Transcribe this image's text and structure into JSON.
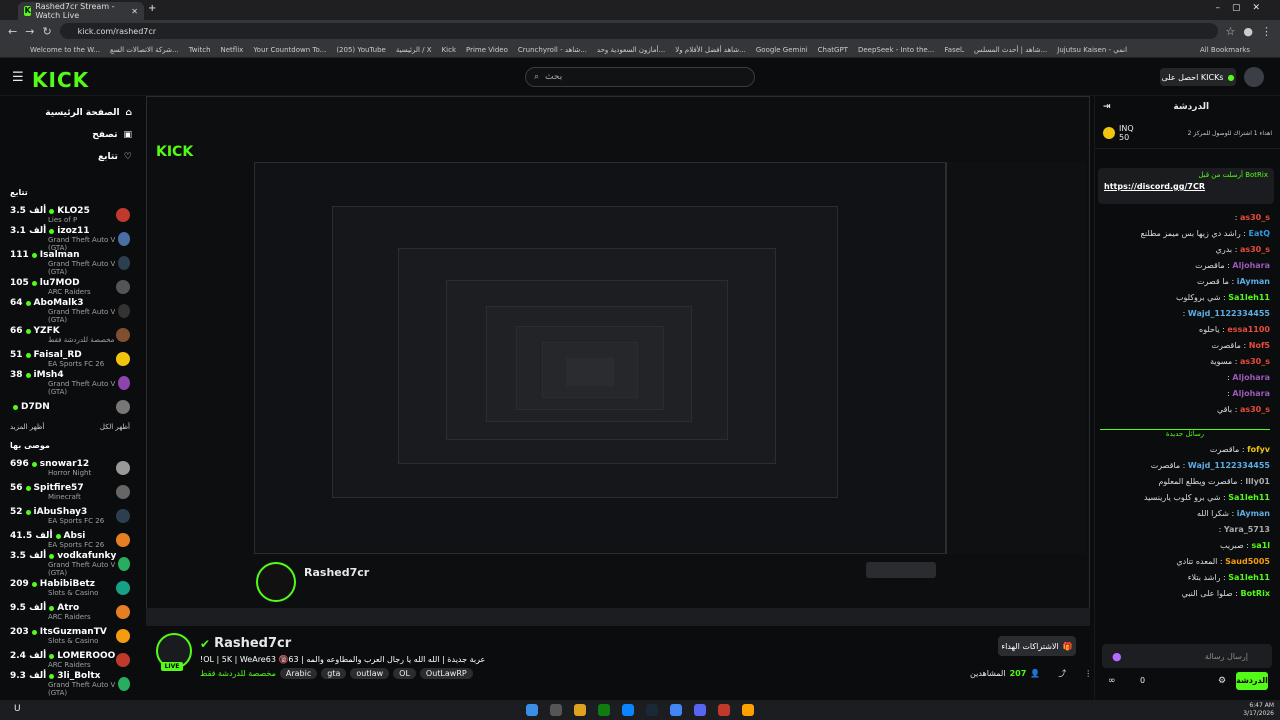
{
  "browser": {
    "tab_title": "Rashed7cr Stream - Watch Live",
    "url": "kick.com/rashed7cr",
    "bookmarks": [
      "Welcome to the W...",
      "شركة الاتصالات السع...",
      "Twitch",
      "Netflix",
      "Your Countdown To...",
      "(205) YouTube",
      "الرئيسية / X",
      "Kick",
      "Prime Video",
      "Crunchyroll - شاهد...",
      "أمازون السعودية وحد...",
      "شاهد أفضل الأفلام ولا...",
      "Google Gemini",
      "ChatGPT",
      "DeepSeek - Into the...",
      "Faselـ",
      "شاهد | أحدث المسلس...",
      "Jujutsu Kaisen - انمي"
    ],
    "all_bookmarks": "All Bookmarks"
  },
  "topbar": {
    "logo": "KICK",
    "search_placeholder": "بحث",
    "get_kicks": "احصل على KICKs"
  },
  "sidebar": {
    "nav": [
      "الصفحة الرئيسية",
      "تصفح",
      "تتابع"
    ],
    "following_title": "تتابع",
    "following": [
      {
        "viewers": "3.5 ألف",
        "name": "KLO25",
        "game": "Lies of P",
        "color": "#c0392b"
      },
      {
        "viewers": "3.1 ألف",
        "name": "izoz11",
        "game": "Grand Theft Auto V (GTA)",
        "color": "#4a6fa5"
      },
      {
        "viewers": "111",
        "name": "Isalman",
        "game": "Grand Theft Auto V (GTA)",
        "color": "#2c3e50"
      },
      {
        "viewers": "105",
        "name": "lu7MOD",
        "game": "ARC Raiders",
        "color": "#555"
      },
      {
        "viewers": "64",
        "name": "AboMalk3",
        "game": "Grand Theft Auto V (GTA)",
        "color": "#333"
      },
      {
        "viewers": "66",
        "name": "YZFK",
        "game": "مخصصة للدردشة فقط",
        "color": "#7f4f2f"
      },
      {
        "viewers": "51",
        "name": "Faisal_RD",
        "game": "EA Sports FC 26",
        "color": "#f1c40f"
      },
      {
        "viewers": "38",
        "name": "iMsh4",
        "game": "Grand Theft Auto V (GTA)",
        "color": "#8e44ad"
      },
      {
        "viewers": "",
        "name": "D7DN",
        "game": "",
        "color": "#777"
      }
    ],
    "show_more": "أظهر المزيد",
    "show_all": "أظهر الكل",
    "recommended_title": "موصى بها",
    "recommended": [
      {
        "viewers": "696",
        "name": "snowar12",
        "game": "Horror Night",
        "color": "#999"
      },
      {
        "viewers": "56",
        "name": "Spitfire57",
        "game": "Minecraft",
        "color": "#666"
      },
      {
        "viewers": "52",
        "name": "iAbuShay3",
        "game": "EA Sports FC 26",
        "color": "#2c3e50"
      },
      {
        "viewers": "41.5 ألف",
        "name": "Absi",
        "game": "EA Sports FC 26",
        "color": "#e67e22"
      },
      {
        "viewers": "3.5 ألف",
        "name": "vodkafunky",
        "game": "Grand Theft Auto V (GTA)",
        "color": "#27ae60"
      },
      {
        "viewers": "209",
        "name": "HabibiBetz",
        "game": "Slots & Casino",
        "color": "#16a085"
      },
      {
        "viewers": "9.5 ألف",
        "name": "Atro",
        "game": "ARC Raiders",
        "color": "#e67e22"
      },
      {
        "viewers": "203",
        "name": "ItsGuzmanTV",
        "game": "Slots & Casino",
        "color": "#f39c12"
      },
      {
        "viewers": "2.4 ألف",
        "name": "LOMEROOO",
        "game": "ARC Raiders",
        "color": "#c0392b"
      },
      {
        "viewers": "9.3 ألف",
        "name": "3li_Boltx",
        "game": "Grand Theft Auto V (GTA)",
        "color": "#27ae60"
      }
    ]
  },
  "channel": {
    "name": "Rashed7cr",
    "live": "LIVE",
    "title": "!OL | 5K | WeAre63 🔞63 | عربة جديدة | الله الله يا رجال العرب والمطاوعه والمه",
    "category": "مخصصة للدردشة فقط",
    "tags": [
      "Arabic",
      "gta",
      "outlaw",
      "OL",
      "OutLawRP"
    ],
    "subscribe": "الاشتراكات الهداء",
    "viewers": "207",
    "viewers_label": "المشاهدين"
  },
  "chat": {
    "title": "الدردشة",
    "top_user": "INQ",
    "top_amount": "50",
    "top_text": "اهداء 1 اشتراك للوصول للمركز 2",
    "pinned_by": "أرسلت من قبل BotRix",
    "pinned_link": "https://discord.gg/7CR",
    "messages": [
      {
        "user": "as30_s",
        "text": "",
        "color": "#e74c3c"
      },
      {
        "user": "EatQ",
        "text": "راشد دي زيها بس ميمز مطلنع",
        "color": "#3498db"
      },
      {
        "user": "as30_s",
        "text": "بدري",
        "color": "#e74c3c"
      },
      {
        "user": "Aljohara",
        "text": "ماقصرت",
        "color": "#9b59b6"
      },
      {
        "user": "iAyman",
        "text": "ما قصرت",
        "color": "#5dade2"
      },
      {
        "user": "Sa1leh11",
        "text": "شي بروكلوب",
        "color": "#53fc18"
      },
      {
        "user": "Wajd_1122334455",
        "text": "",
        "color": "#5dade2"
      },
      {
        "user": "essa1100",
        "text": "ياحلوه",
        "color": "#e74c3c"
      },
      {
        "user": "Nof5",
        "text": "ماقصرت",
        "color": "#e74c3c"
      },
      {
        "user": "as30_s",
        "text": "مسوية",
        "color": "#e74c3c"
      },
      {
        "user": "Aljohara",
        "text": "",
        "color": "#9b59b6"
      },
      {
        "user": "Aljohara",
        "text": "",
        "color": "#9b59b6"
      },
      {
        "user": "as30_s",
        "text": "باقي",
        "color": "#e74c3c"
      }
    ],
    "new_messages": "رسائل جديدة",
    "messages2": [
      {
        "user": "fofyv",
        "text": "ماقصرت",
        "color": "#f1c40f"
      },
      {
        "user": "Wajd_1122334455",
        "text": "ماقصرت",
        "color": "#5dade2"
      },
      {
        "user": "Illy01",
        "text": "ماقصرت ويطلع المعلوم",
        "color": "#aaa"
      },
      {
        "user": "Sa1leh11",
        "text": "شي برو كلوب يارينسيد",
        "color": "#53fc18"
      },
      {
        "user": "iAyman",
        "text": "شكرا الله",
        "color": "#5dade2"
      },
      {
        "user": "Yara_5713",
        "text": "",
        "color": "#aaa"
      },
      {
        "user": "sa1l",
        "text": "صبريب",
        "color": "#53fc18"
      },
      {
        "user": "Saud5005",
        "text": "المعده تتادي",
        "color": "#f39c12"
      },
      {
        "user": "Sa1leh11",
        "text": "راشد بتلاء",
        "color": "#53fc18"
      },
      {
        "user": "BotRix",
        "text": "صلوا على النبي",
        "color": "#53fc18"
      }
    ],
    "input_placeholder": "إرسال رسالة",
    "send": "الدردشة",
    "count": "0"
  },
  "taskbar": {
    "time": "6:47 AM",
    "date": "3/17/2026"
  }
}
